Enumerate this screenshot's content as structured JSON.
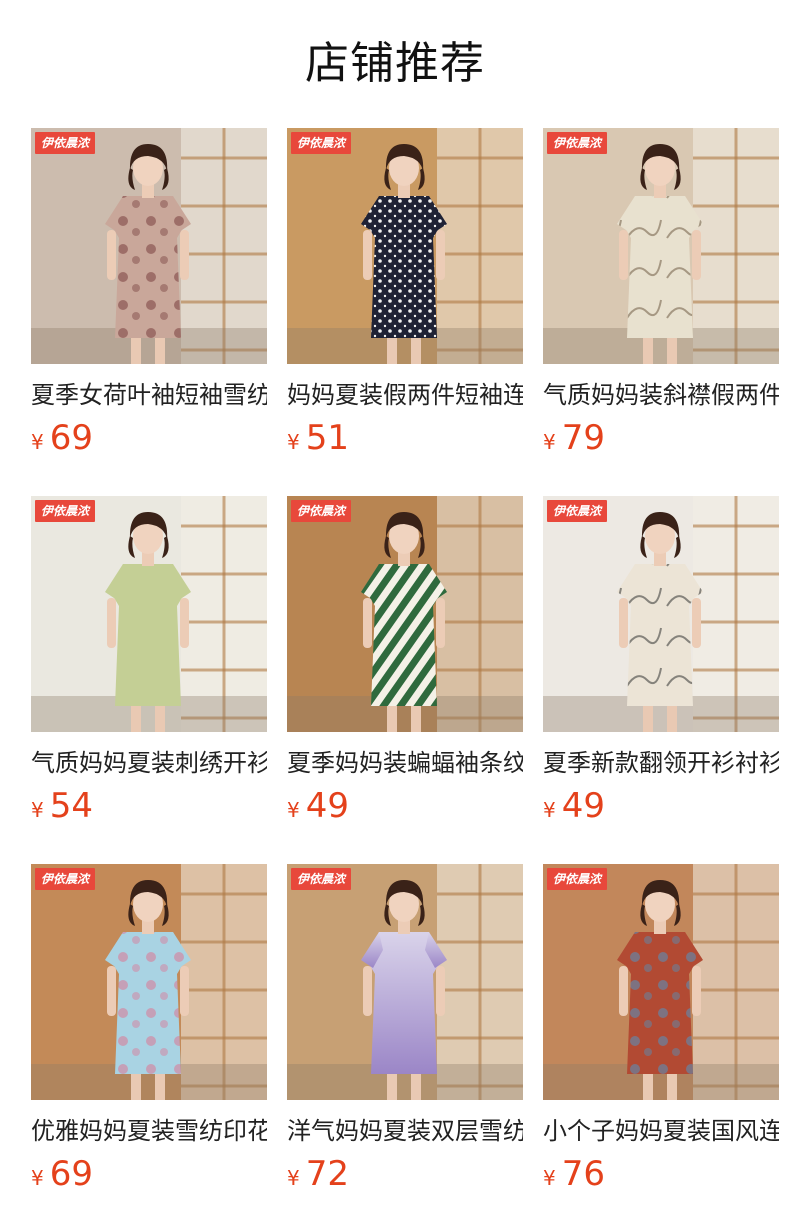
{
  "page": {
    "title": "店铺推荐"
  },
  "products": [
    {
      "title": "夏季女荷叶袖短袖雪纺",
      "currency": "¥",
      "price": "69",
      "badge": "伊依晨浓",
      "dress": "#c9a79a",
      "accent": "#8e5b57",
      "bg": "#ccbcae",
      "style": "floral"
    },
    {
      "title": "妈妈夏装假两件短袖连",
      "currency": "¥",
      "price": "51",
      "badge": "伊依晨浓",
      "dress": "#1f2235",
      "accent": "#f2f2f2",
      "bg": "#c99a62",
      "style": "dots"
    },
    {
      "title": "气质妈妈装斜襟假两件",
      "currency": "¥",
      "price": "79",
      "badge": "伊依晨浓",
      "dress": "#e8e1cf",
      "accent": "#8a7a63",
      "bg": "#d9c8b2",
      "style": "ink"
    },
    {
      "title": "气质妈妈夏装刺绣开衫",
      "currency": "¥",
      "price": "54",
      "badge": "伊依晨浓",
      "dress": "#c4cf95",
      "accent": "#e9ecd6",
      "bg": "#eae8e0",
      "style": "plain"
    },
    {
      "title": "夏季妈妈装蝙蝠袖条纹",
      "currency": "¥",
      "price": "49",
      "badge": "伊依晨浓",
      "dress": "#2f6a3d",
      "accent": "#f4f1e7",
      "bg": "#b88552",
      "style": "stripes"
    },
    {
      "title": "夏季新款翻领开衫衬衫",
      "currency": "¥",
      "price": "49",
      "badge": "伊依晨浓",
      "dress": "#ece4d6",
      "accent": "#5c5a55",
      "bg": "#ede9e3",
      "style": "ink"
    },
    {
      "title": "优雅妈妈夏装雪纺印花",
      "currency": "¥",
      "price": "69",
      "badge": "伊依晨浓",
      "dress": "#a9d3e3",
      "accent": "#cf8ea8",
      "bg": "#c38a58",
      "style": "floral"
    },
    {
      "title": "洋气妈妈夏装双层雪纺",
      "currency": "¥",
      "price": "72",
      "badge": "伊依晨浓",
      "dress": "#9b86c7",
      "accent": "#d9d3ea",
      "bg": "#c7a074",
      "style": "gradient"
    },
    {
      "title": "小个子妈妈夏装国风连",
      "currency": "¥",
      "price": "76",
      "badge": "伊依晨浓",
      "dress": "#b24a33",
      "accent": "#6b7e9a",
      "bg": "#c2875b",
      "style": "floral"
    }
  ]
}
